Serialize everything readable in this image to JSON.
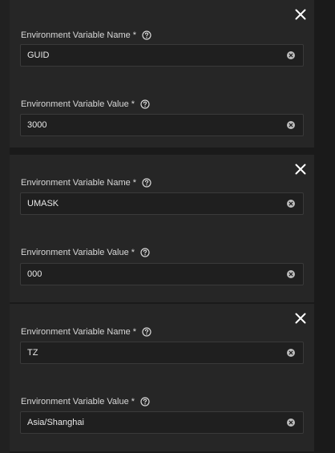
{
  "required_marker": "*",
  "rows": [
    {
      "name_label": "Environment Variable Name",
      "name_value": "GUID",
      "value_label": "Environment Variable Value",
      "value_value": "3000"
    },
    {
      "name_label": "Environment Variable Name",
      "name_value": "UMASK",
      "value_label": "Environment Variable Value",
      "value_value": "000"
    },
    {
      "name_label": "Environment Variable Name",
      "name_value": "TZ",
      "value_label": "Environment Variable Value",
      "value_value": "Asia/Shanghai"
    }
  ],
  "icons": {
    "remove": "close-icon",
    "help": "help-circle-icon",
    "clear": "clear-input-icon"
  },
  "colors": {
    "background": "#1a1a1a",
    "card": "#262626",
    "input_background": "#1f1f1f",
    "input_border": "#3a3a3a",
    "text": "#e6e6e6"
  }
}
